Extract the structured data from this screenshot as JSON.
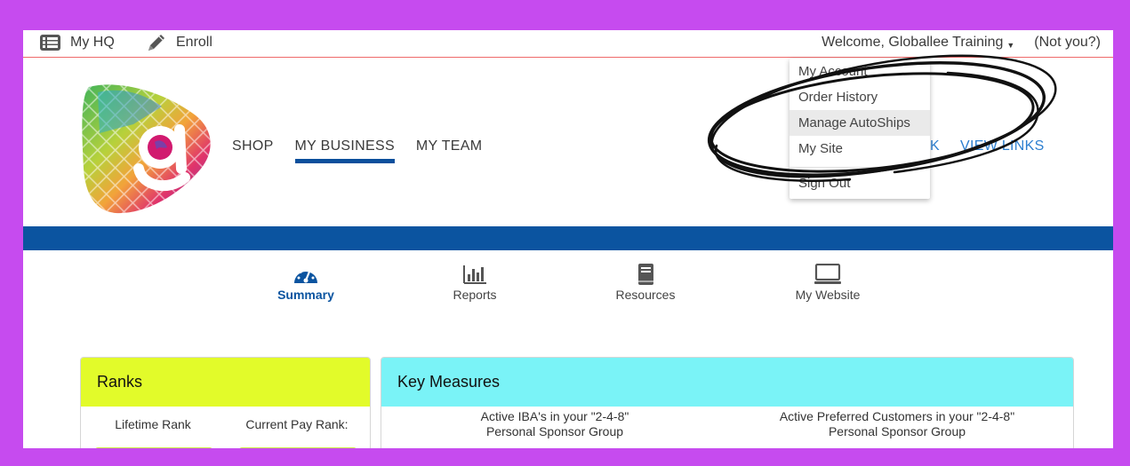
{
  "topbar": {
    "my_hq": "My HQ",
    "enroll": "Enroll",
    "welcome": "Welcome, Globallee Training",
    "not_you": "(Not you?)"
  },
  "nav": {
    "items": [
      "SHOP",
      "MY BUSINESS",
      "MY TEAM"
    ],
    "active": "MY BUSINESS"
  },
  "header_links": {
    "partial": "K",
    "view_links": "VIEW LINKS"
  },
  "dropdown": {
    "items": [
      "My Account",
      "Order History",
      "Manage AutoShips",
      "My Site",
      "Sign Out"
    ],
    "highlighted": "Manage AutoShips"
  },
  "tabs": [
    {
      "label": "Summary",
      "icon": "speedometer-icon",
      "active": true
    },
    {
      "label": "Reports",
      "icon": "bar-chart-icon",
      "active": false
    },
    {
      "label": "Resources",
      "icon": "book-icon",
      "active": false
    },
    {
      "label": "My Website",
      "icon": "monitor-icon",
      "active": false
    }
  ],
  "ranks": {
    "title": "Ranks",
    "lifetime_rank": "Lifetime Rank",
    "current_pay_rank": "Current Pay Rank:"
  },
  "key_measures": {
    "title": "Key Measures",
    "col1_line1": "Active IBA's in your \"2-4-8\"",
    "col1_line2": "Personal Sponsor Group",
    "col2_line1": "Active Preferred Customers in your \"2-4-8\"",
    "col2_line2": "Personal Sponsor Group"
  },
  "colors": {
    "background": "#c64bef",
    "brand_blue": "#0b54a0",
    "link_blue": "#2d7fd0",
    "ranks_header": "#e2fb2a",
    "key_measures_header": "#7af3f7",
    "topbar_border": "#ef6a6a"
  }
}
